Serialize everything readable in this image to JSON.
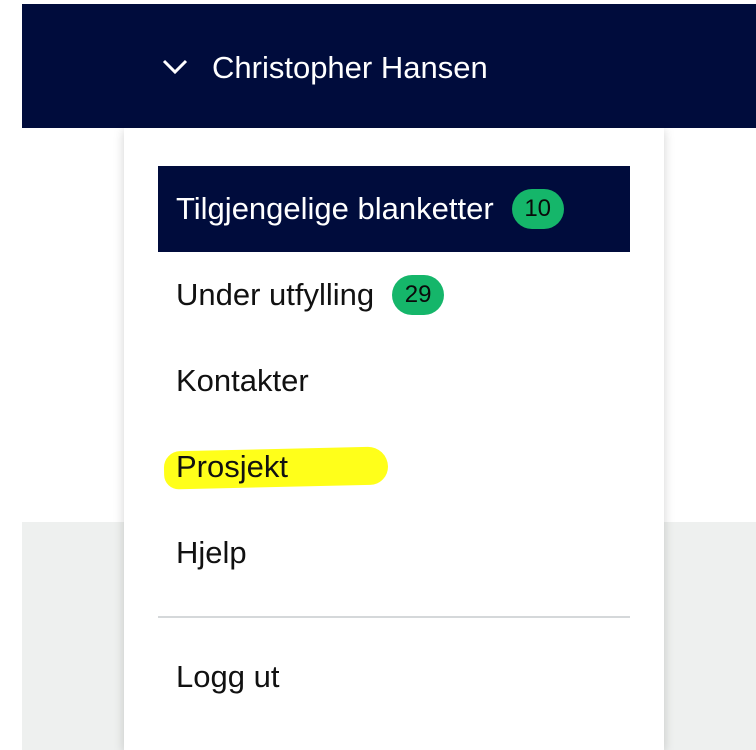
{
  "header": {
    "user_name": "Christopher Hansen",
    "chevron_icon": "chevron-down-icon",
    "background_color": "#000c3c"
  },
  "menu": {
    "items": [
      {
        "label": "Tilgjengelige blanketter",
        "badge": "10",
        "active": true
      },
      {
        "label": "Under utfylling",
        "badge": "29",
        "active": false
      },
      {
        "label": "Kontakter",
        "active": false
      },
      {
        "label": "Prosjekt",
        "active": false,
        "highlighted": true
      },
      {
        "label": "Hjelp",
        "active": false
      }
    ],
    "logout_label": "Logg ut",
    "badge_color": "#15b66a",
    "highlight_color": "#ffff1a"
  }
}
